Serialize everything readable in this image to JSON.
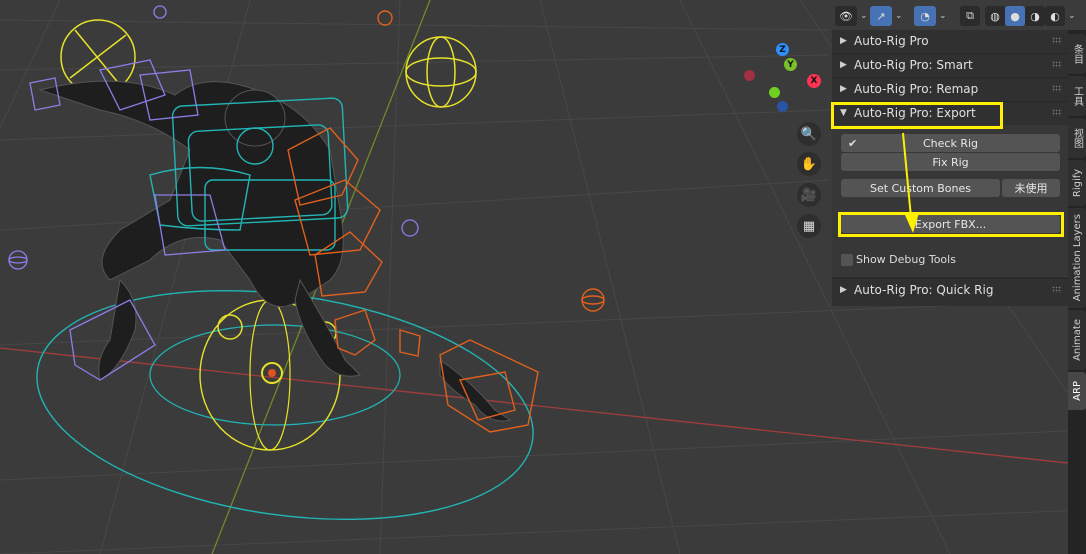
{
  "toolbar": {
    "icons": [
      "eye-icon",
      "gizmo-icon",
      "overlay-icon",
      "xray-icon",
      "wireframe-shading-icon",
      "solid-shading-icon",
      "material-shading-icon",
      "rendered-shading-icon"
    ]
  },
  "gizmo": {
    "z_label": "Z",
    "y_label": "Y",
    "x_label": "X"
  },
  "navigation": [
    "zoom-icon",
    "pan-hand-icon",
    "camera-icon",
    "grid-perspective-icon"
  ],
  "panels": [
    {
      "label": "Auto-Rig Pro",
      "expanded": false
    },
    {
      "label": "Auto-Rig Pro: Smart",
      "expanded": false
    },
    {
      "label": "Auto-Rig Pro: Remap",
      "expanded": false
    },
    {
      "label": "Auto-Rig Pro: Export",
      "expanded": true
    },
    {
      "label": "Auto-Rig Pro: Quick Rig",
      "expanded": false
    }
  ],
  "export_panel": {
    "check_rig": "Check Rig",
    "fix_rig": "Fix Rig",
    "set_custom_bones": "Set Custom Bones",
    "unused": "未使用",
    "export_fbx": "Export FBX...",
    "show_debug_tools": "Show Debug Tools"
  },
  "tabs": [
    {
      "label": "条目",
      "active": false
    },
    {
      "label": "工具",
      "active": false
    },
    {
      "label": "视图",
      "active": false
    },
    {
      "label": "Rigify",
      "active": false
    },
    {
      "label": "Animation Layers",
      "active": false
    },
    {
      "label": "Animate",
      "active": false
    },
    {
      "label": "ARP",
      "active": true
    }
  ],
  "colors": {
    "viewport_bg": "#3b3b3b",
    "panel_bg": "#303030",
    "highlight": "#ffef00",
    "active_blue": "#4772b3",
    "bone_cyan": "#22b5b5",
    "bone_orange": "#e0601e",
    "bone_yellow": "#e6e22a",
    "bone_purple": "#8c7ee6"
  }
}
